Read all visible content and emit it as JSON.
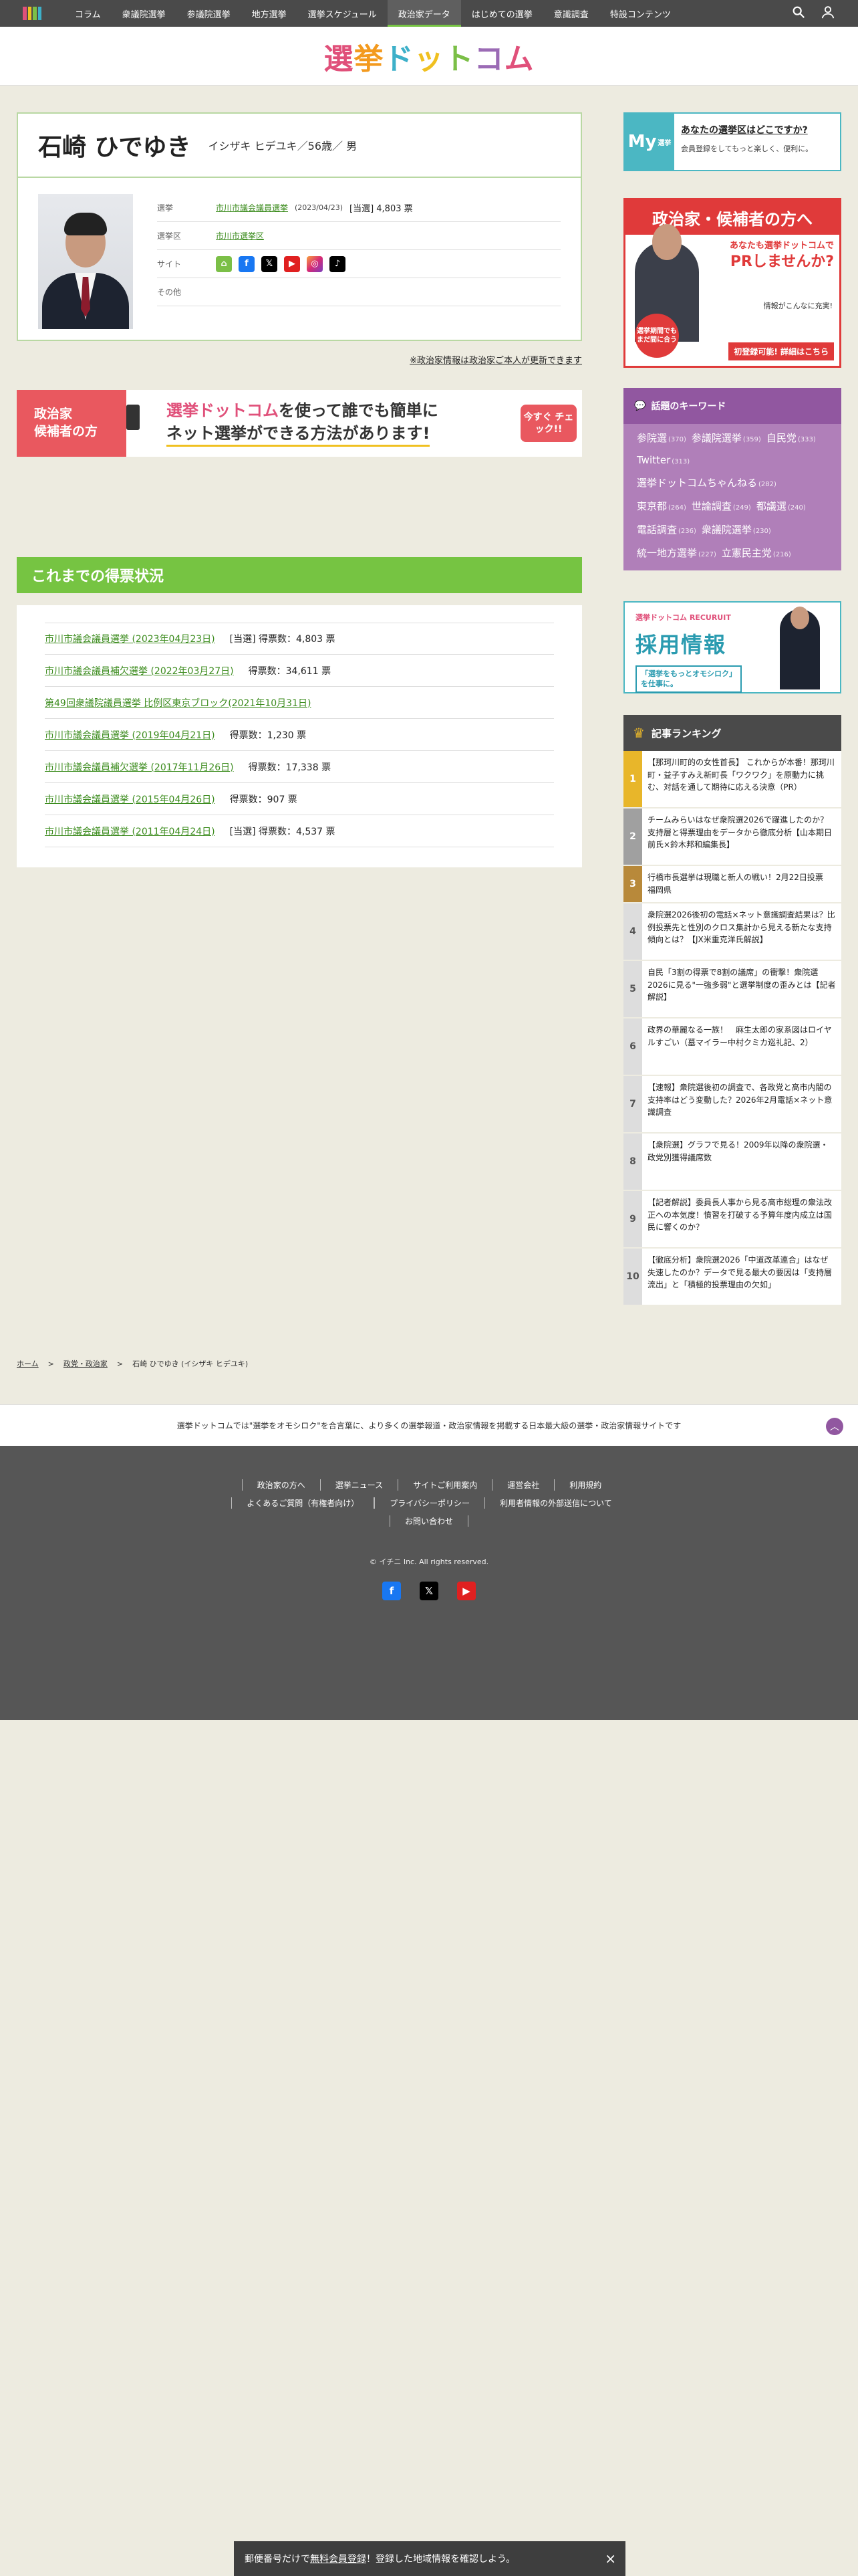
{
  "nav": {
    "items": [
      "コラム",
      "衆議院選挙",
      "参議院選挙",
      "地方選挙",
      "選挙スケジュール",
      "政治家データ",
      "はじめての選挙",
      "意識調査",
      "特設コンテンツ"
    ],
    "active_index": 5
  },
  "site_logo": "選挙ドットコム",
  "profile": {
    "name": "石崎 ひでゆき",
    "kana_age_gender": "イシザキ ヒデユキ／56歳／ 男",
    "election_label": "選挙",
    "election_link": "市川市議会議員選挙",
    "election_date": "(2023/04/23)",
    "election_result": "[当選] 4,803 票",
    "district_label": "選挙区",
    "district_link": "市川市選挙区",
    "site_label": "サイト",
    "other_label": "その他"
  },
  "update_note": "※政治家情報は政治家ご本人が更新できます",
  "banner": {
    "left_line1": "政治家",
    "left_line2": "候補者の方",
    "mid_logo": "選挙ドットコム",
    "mid_line1_rest": "を使って誰でも簡単に",
    "mid_line2": "ネット選挙ができる方法があります!",
    "check": "今すぐ チェック!!"
  },
  "history": {
    "title": "これまでの得票状況",
    "rows": [
      {
        "link": "市川市議会議員選挙 (2023年04月23日)",
        "result": "[当選] 得票数：4,803 票"
      },
      {
        "link": "市川市議会議員補欠選挙 (2022年03月27日)",
        "result": "得票数：34,611 票"
      },
      {
        "link": "第49回衆議院議員選挙 比例区東京ブロック(2021年10月31日)",
        "result": ""
      },
      {
        "link": "市川市議会議員選挙 (2019年04月21日)",
        "result": "得票数：1,230 票"
      },
      {
        "link": "市川市議会議員補欠選挙 (2017年11月26日)",
        "result": "得票数：17,338 票"
      },
      {
        "link": "市川市議会議員選挙 (2015年04月26日)",
        "result": "得票数：907 票"
      },
      {
        "link": "市川市議会議員選挙 (2011年04月24日)",
        "result": "[当選] 得票数：4,537 票"
      }
    ]
  },
  "side": {
    "my_logo": "My",
    "my_logo_small": "選挙",
    "my_title": "あなたの選挙区はどこですか?",
    "my_sub": "会員登録をしてもっと楽しく、便利に。",
    "pr_top": "政治家・候補者の方へ",
    "pr_q1": "あなたも選挙ドットコムで",
    "pr_q2": "PRしませんか?",
    "pr_circle": "選挙期間でもまだ間に合う",
    "pr_mini": "情報がこんなに充実!",
    "pr_bottom": "初登録可能! 詳細はこちら",
    "kw_title": "話題のキーワード",
    "keywords": [
      {
        "word": "参院選",
        "count": "(370)"
      },
      {
        "word": "参議院選挙",
        "count": "(359)"
      },
      {
        "word": "自民党",
        "count": "(333)"
      },
      {
        "word": "Twitter",
        "count": "(313)"
      },
      {
        "word": "選挙ドットコムちゃんねる",
        "count": "(282)"
      },
      {
        "word": "東京都",
        "count": "(264)"
      },
      {
        "word": "世論調査",
        "count": "(249)"
      },
      {
        "word": "都議選",
        "count": "(240)"
      },
      {
        "word": "電話調査",
        "count": "(236)"
      },
      {
        "word": "衆議院選挙",
        "count": "(230)"
      },
      {
        "word": "統一地方選挙",
        "count": "(227)"
      },
      {
        "word": "立憲民主党",
        "count": "(216)"
      }
    ],
    "recruit_top": "選挙ドットコム RECURUIT",
    "recruit_title": "採用情報",
    "recruit_sub1": "「選挙をもっとオモシロク」",
    "recruit_sub2": "を仕事に。",
    "rank_title": "記事ランキング",
    "ranking": [
      "【那珂川町的の女性首長】 これからが本番！那珂川町・益子すみえ新町長「ワクワク」を原動力に挑む、対話を通して期待に応える決意（PR）",
      "チームみらいはなぜ衆院選2026で躍進したのか？支持層と得票理由をデータから徹底分析【山本期日前氏×鈴木邦和編集長】",
      "行橋市長選挙は現職と新人の戦い！2月22日投票　福岡県",
      "衆院選2026後初の電話×ネット意識調査結果は？比例投票先と性別のクロス集計から見える新たな支持傾向とは？【JX米重克洋氏解説】",
      "自民「3割の得票で8割の議席」の衝撃！衆院選2026に見る\"一強多弱\"と選挙制度の歪みとは【記者解説】",
      "政界の華麗なる一族！　麻生太郎の家系図はロイヤルすごい（墓マイラー中村クミカ巡礼記、2）",
      "【速報】衆院選後初の調査で、各政党と高市内閣の支持率はどう変動した？2026年2月電話×ネット意識調査",
      "【衆院選】グラフで見る！2009年以降の衆院選・政党別獲得議席数",
      "【記者解説】委員長人事から見る高市総理の衆法改正への本気度！憤習を打破する予算年度内成立は国民に響くのか？",
      "【徹底分析】衆院選2026「中道改革連合」はなぜ失速したのか？データで見る最大の要因は「支持層流出」と「積極的投票理由の欠如」"
    ]
  },
  "breadcrumb": {
    "home": "ホーム",
    "category": "政党・政治家",
    "current": "石崎 ひでゆき (イシザキ ヒデユキ)"
  },
  "about": "選挙ドットコムでは\"選挙をオモシロク\"を合言葉に、より多くの選挙報道・政治家情報を掲載する日本最大級の選挙・政治家情報サイトです",
  "footer": {
    "links": [
      "政治家の方へ",
      "選挙ニュース",
      "サイトご利用案内",
      "運営会社",
      "利用規約",
      "よくあるご質問（有権者向け）",
      "プライバシーポリシー",
      "利用者情報の外部送信について",
      "お問い合わせ"
    ],
    "copyright": "© イチニ Inc. All rights reserved."
  },
  "bottom_bar": {
    "pre": "郵便番号だけで",
    "link": "無料会員登録",
    "post": "！登録した地域情報を確認しよう。"
  },
  "colors": {
    "accent_green": "#76c442",
    "link_green": "#3c8c1e",
    "keyword_purple": "#b07fb9",
    "brand_pink": "#e0507a"
  }
}
